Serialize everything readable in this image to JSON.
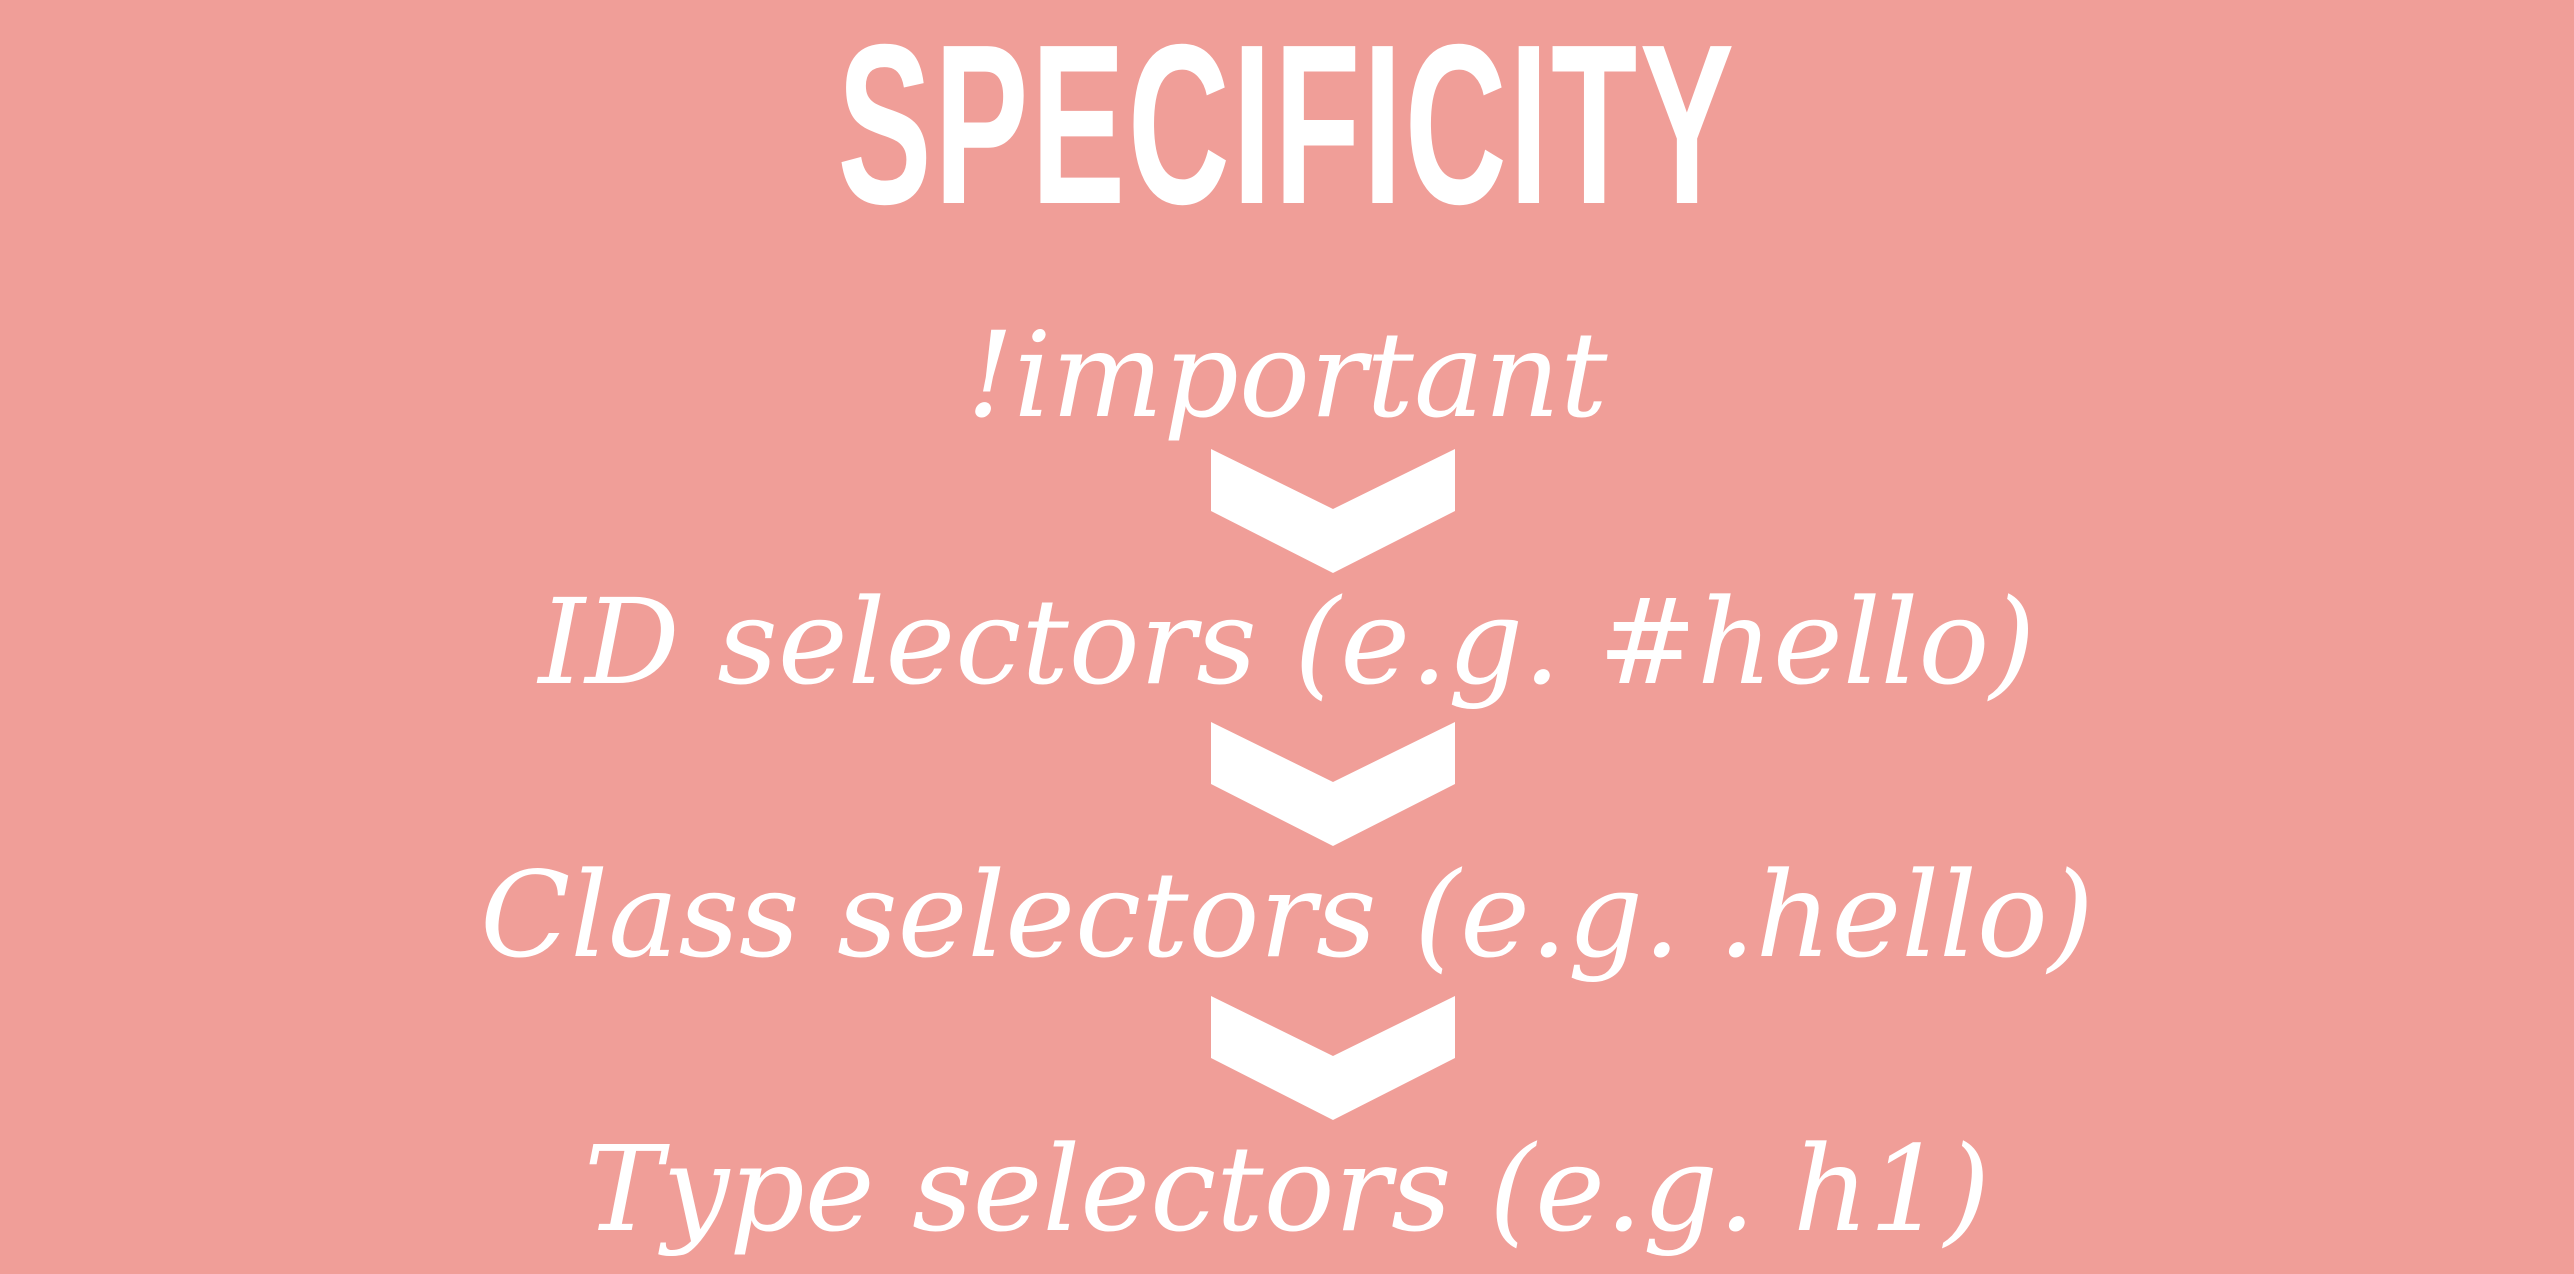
{
  "slide": {
    "title": "SPECIFICITY",
    "background_color": "#f09e98",
    "text_color": "#ffffff",
    "levels": [
      {
        "label": "!important"
      },
      {
        "label": "ID selectors (e.g. #hello)"
      },
      {
        "label": "Class selectors (e.g. .hello)"
      },
      {
        "label": "Type selectors (e.g. h1)"
      }
    ],
    "separator_icon": "chevron-down-icon"
  }
}
